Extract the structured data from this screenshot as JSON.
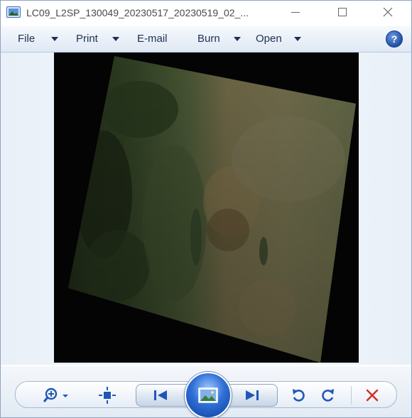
{
  "window": {
    "title": "LC09_L2SP_130049_20230517_20230519_02_...",
    "icon": "photo-viewer-icon"
  },
  "window_controls": {
    "minimize_icon": "minimize-icon",
    "maximize_icon": "maximize-icon",
    "close_icon": "close-icon"
  },
  "menu": {
    "file": "File",
    "print": "Print",
    "email": "E-mail",
    "burn": "Burn",
    "open": "Open",
    "help": "?"
  },
  "viewer": {
    "image": "satellite-image"
  },
  "toolbar": {
    "zoom_icon": "zoom-icon",
    "actual_size_icon": "actual-size-icon",
    "previous_icon": "previous-icon",
    "slideshow_icon": "slideshow-icon",
    "next_icon": "next-icon",
    "rotate_ccw_icon": "rotate-counterclockwise-icon",
    "rotate_cw_icon": "rotate-clockwise-icon",
    "delete_icon": "delete-icon"
  },
  "colors": {
    "accent_blue": "#2f6fd6",
    "delete_red": "#d0342c",
    "menu_text": "#1e3050"
  }
}
